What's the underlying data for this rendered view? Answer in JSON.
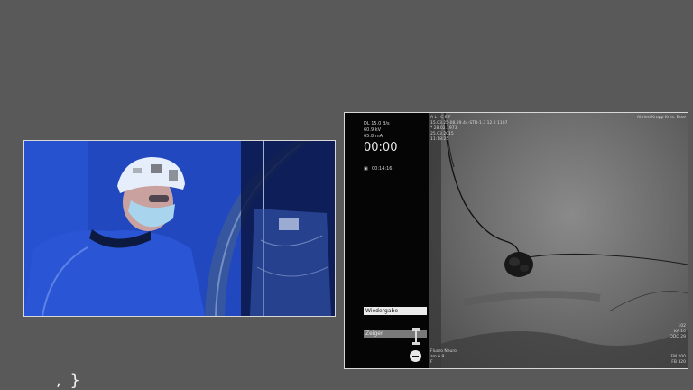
{
  "fluoro": {
    "side": {
      "dl": "DL 15.0 B/s",
      "kv": "60.9 kV",
      "ma": "65.8 mA",
      "clock": "00:00",
      "total_time": "00:14:16",
      "playback_label": "Wiedergabe",
      "pointer_label": "Zeiger"
    },
    "header": {
      "patient": "A L I C E  F",
      "study_line": "15.03.25-08.29.44-STD-1.3 12.2 1107",
      "birth": "* 28.02.1973",
      "date": "25.03.2015",
      "time": "11:18:25",
      "institution": "Alfried Krupp Krhs. Esse"
    },
    "footer": {
      "program": "Fluoro Neuro",
      "zoom": "zm 6.9",
      "f": "F"
    },
    "right_overlay": {
      "r1": "102",
      "r2": "KA 10",
      "r3": "ODO 29",
      "r4": "FM 200",
      "r5": "FB 320"
    }
  },
  "caption": {
    "text": ", }"
  }
}
